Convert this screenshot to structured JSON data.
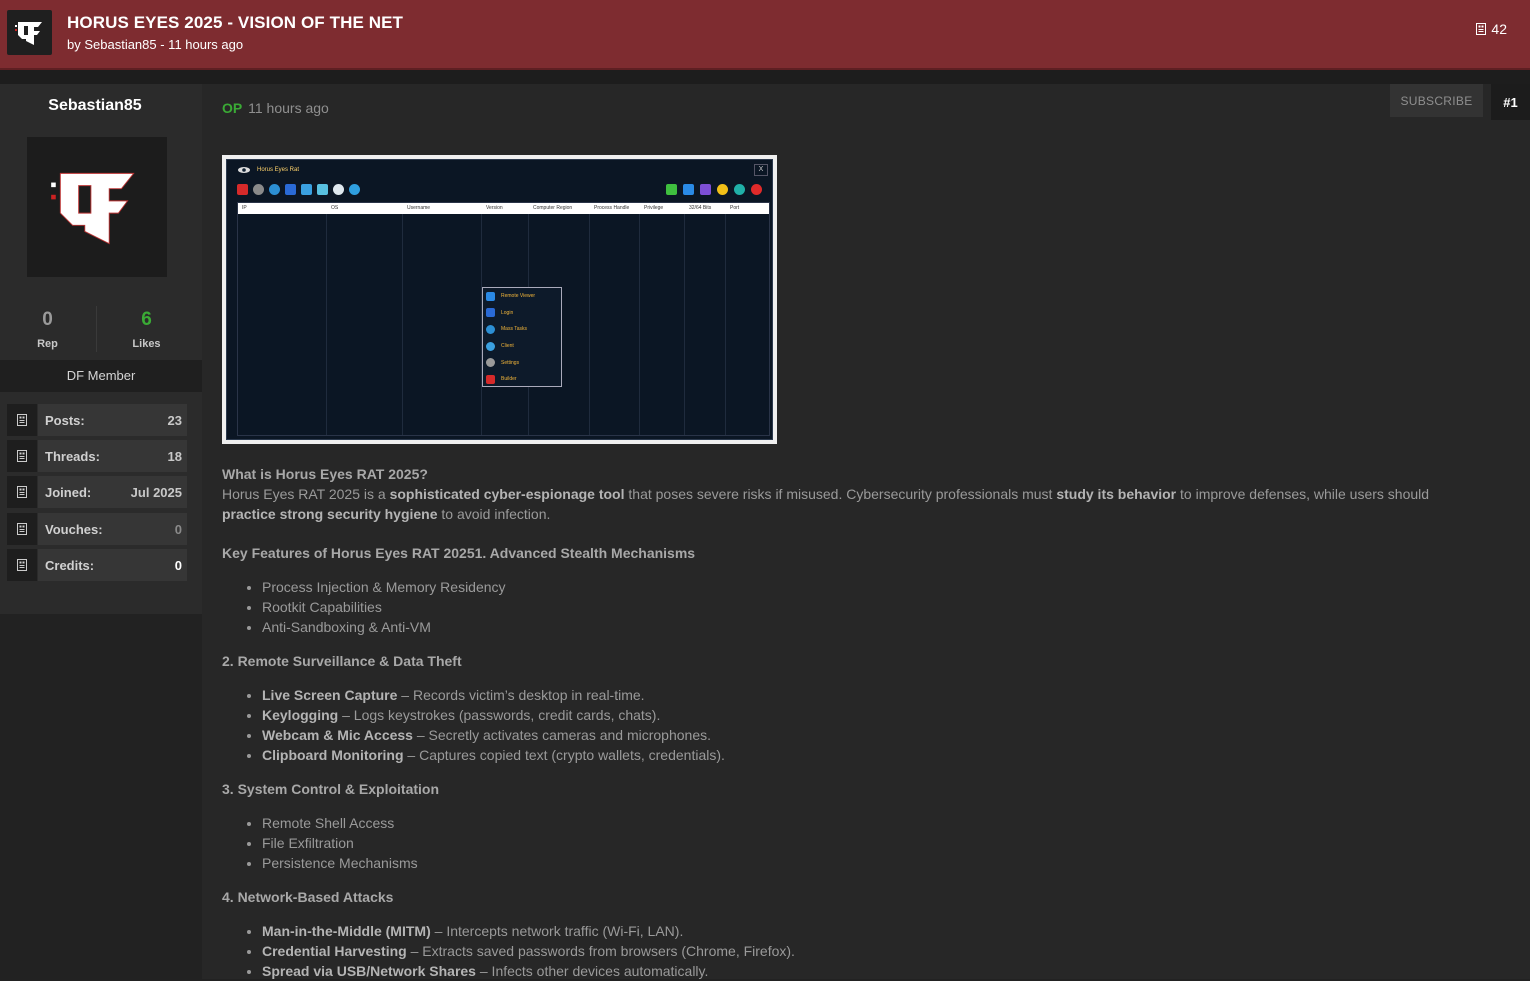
{
  "header": {
    "title": "HORUS EYES 2025 - VISION OF THE NET",
    "meta": "by Sebastian85 - 11 hours ago",
    "views": "42"
  },
  "user": {
    "name": "Sebastian85",
    "rep_value": "0",
    "rep_label": "Rep",
    "likes_value": "6",
    "likes_label": "Likes",
    "role": "DF Member",
    "info": [
      {
        "label": "Posts:",
        "value": "23"
      },
      {
        "label": "Threads:",
        "value": "18"
      },
      {
        "label": "Joined:",
        "value": "Jul 2025"
      },
      {
        "label": "Vouches:",
        "value": "0"
      },
      {
        "label": "Credits:",
        "value": "0"
      }
    ]
  },
  "post": {
    "op_tag": "OP",
    "time": "11 hours ago",
    "subscribe": "SUBSCRIBE",
    "number": "#1",
    "image": {
      "window_title": "Horus Eyes Rat",
      "close": "X",
      "columns": [
        "IP",
        "OS",
        "Username",
        "Version",
        "Computer Region",
        "Process Handle",
        "Privilege",
        "32/64 Bits",
        "Port"
      ],
      "menu": [
        "Remote Viewer",
        "Login",
        "Mass Tasks",
        "Client",
        "Settings",
        "Builder"
      ]
    },
    "q1": "What is Horus Eyes RAT 2025?",
    "intro": {
      "t1": "Horus Eyes RAT 2025 is a ",
      "b1": "sophisticated cyber-espionage tool",
      "t2": " that poses severe risks if misused. Cybersecurity professionals must ",
      "b2": "study its behavior",
      "t3": " to improve defenses, while users should ",
      "b3": "practice strong security hygiene",
      "t4": " to avoid infection."
    },
    "key_heading": "Key Features of Horus Eyes RAT 20251. Advanced Stealth Mechanisms",
    "list1": [
      "Process Injection & Memory Residency",
      "Rootkit Capabilities",
      "Anti-Sandboxing & Anti-VM"
    ],
    "h2": "2. Remote Surveillance & Data Theft",
    "list2": [
      {
        "b": "Live Screen Capture",
        "t": " – Records victim’s desktop in real-time."
      },
      {
        "b": "Keylogging",
        "t": " – Logs keystrokes (passwords, credit cards, chats)."
      },
      {
        "b": "Webcam & Mic Access",
        "t": " – Secretly activates cameras and microphones."
      },
      {
        "b": "Clipboard Monitoring",
        "t": " – Captures copied text (crypto wallets, credentials)."
      }
    ],
    "h3": "3. System Control & Exploitation",
    "list3": [
      "Remote Shell Access",
      "File Exfiltration",
      "Persistence Mechanisms"
    ],
    "h4": "4. Network-Based Attacks",
    "list4": [
      {
        "b": "Man-in-the-Middle (MITM)",
        "t": " – Intercepts network traffic (Wi-Fi, LAN)."
      },
      {
        "b": "Credential Harvesting",
        "t": " – Extracts saved passwords from browsers (Chrome, Firefox)."
      },
      {
        "b": "Spread via USB/Network Shares",
        "t": " – Infects other devices automatically."
      }
    ]
  },
  "colors": {
    "header_bg": "#7e2c30",
    "op_green": "#3aaa35",
    "likes_green": "#3aaa35"
  }
}
